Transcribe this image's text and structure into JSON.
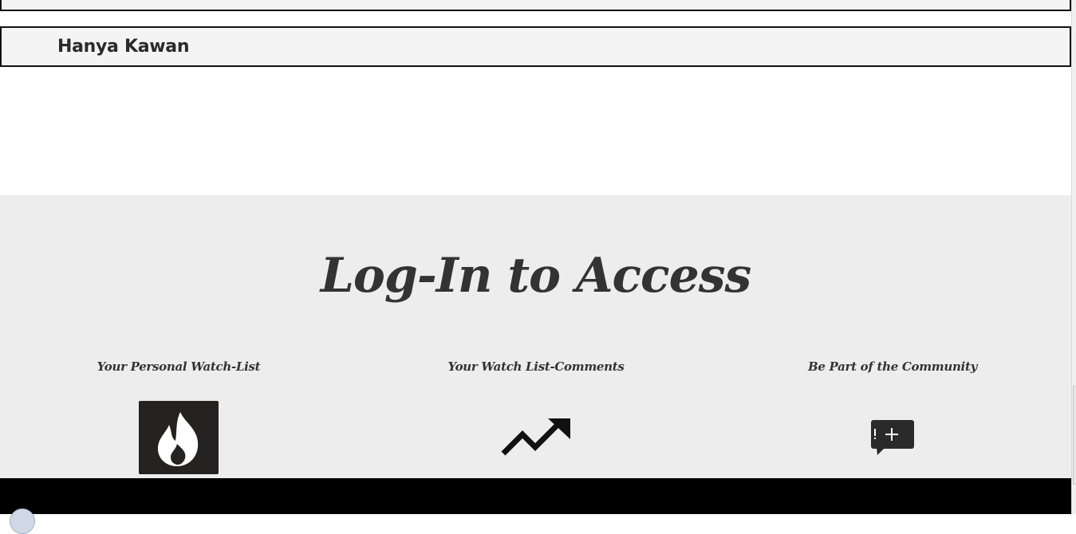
{
  "profile": {
    "name": "Hanya Kawan"
  },
  "login": {
    "heading": "Log-In to Access",
    "features": [
      {
        "label": "Your Personal Watch-List",
        "icon": "flame-icon"
      },
      {
        "label": "Your Watch List-Comments",
        "icon": "trending-up-icon"
      },
      {
        "label": "Be Part of the Community",
        "icon": "chat-add-icon"
      }
    ]
  },
  "colors": {
    "section_bg": "#ededed",
    "footer_bg": "#000000",
    "icon_dark": "#222222"
  }
}
